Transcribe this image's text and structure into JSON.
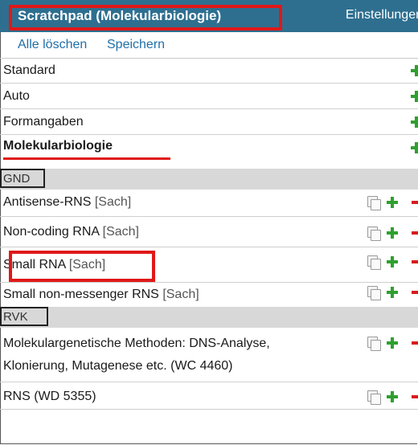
{
  "header": {
    "title": "Scratchpad (Molekularbiologie)",
    "settings_label": "Einstellungen"
  },
  "toolbar": {
    "clear_all": "Alle löschen",
    "save": "Speichern"
  },
  "profiles": [
    {
      "label": "Standard"
    },
    {
      "label": "Auto"
    },
    {
      "label": "Formangaben"
    },
    {
      "label": "Molekularbiologie"
    }
  ],
  "sections": {
    "gnd": {
      "label": "GND",
      "items": [
        {
          "name": "Antisense-RNS",
          "type": "[Sach]"
        },
        {
          "name": "Non-coding RNA",
          "type": "[Sach]"
        },
        {
          "name": "Small RNA",
          "type": "[Sach]"
        },
        {
          "name": "Small non-messenger RNS",
          "type": "[Sach]"
        }
      ]
    },
    "rvk": {
      "label": "RVK",
      "items": [
        {
          "line1": "Molekulargenetische Methoden: DNS-Analyse,",
          "line2": "Klonierung, Mutagenese etc. (WC 4460)"
        },
        {
          "line1": "RNS (WD 5355)"
        }
      ]
    }
  },
  "colors": {
    "header_bg": "#2e6f90",
    "link": "#1f6fa8",
    "add_icon": "#2ea02e",
    "remove_icon": "#d81b1b",
    "highlight": "#e01818",
    "section_bg": "#d8d8d8"
  },
  "icons": [
    "copy-icon",
    "add-icon",
    "remove-icon"
  ]
}
